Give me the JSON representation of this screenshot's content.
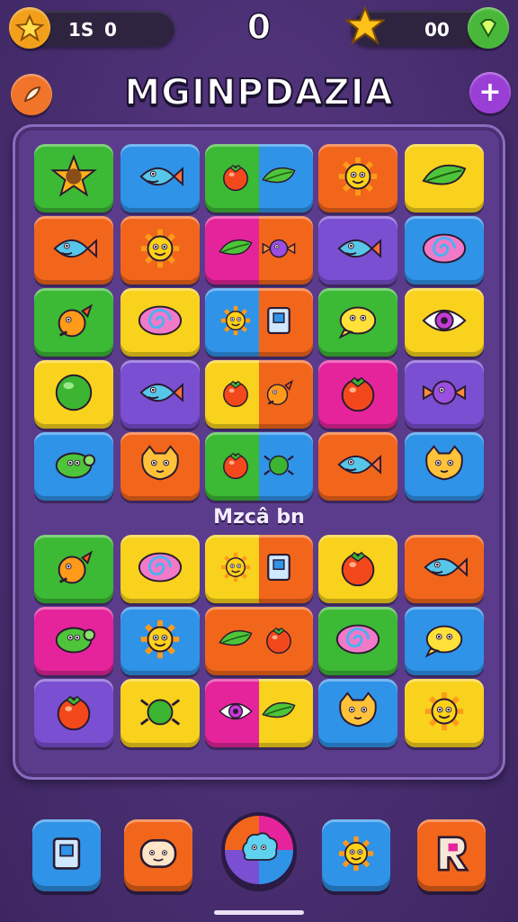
{
  "hud": {
    "left_counter_a": "1̸",
    "left_counter_text": "1S",
    "left_counter_value": "0",
    "score": "0",
    "right_counter_value": "00"
  },
  "title": "MGINPDAZIA",
  "section_label": "Mzcâ bn",
  "colors": {
    "green": "#3cb935",
    "blue": "#2f93e8",
    "orange": "#f2661b",
    "yellow": "#f8d21c",
    "pink": "#e5249c",
    "purple": "#7a4fd1",
    "board": "#5b3c8c"
  },
  "grid_top": [
    [
      {
        "c": "green",
        "icon": "star-creature-icon"
      },
      {
        "c": "blue",
        "icon": "fish-icon"
      },
      {
        "c": "green|blue",
        "icon": "pepper-feather-icon"
      },
      {
        "c": "orange",
        "icon": "sun-icon"
      },
      {
        "c": "yellow",
        "icon": "leaf-icon"
      }
    ],
    [
      {
        "c": "orange",
        "icon": "fish-icon"
      },
      {
        "c": "orange",
        "icon": "sun-icon"
      },
      {
        "c": "pink|orange",
        "icon": "leaf-candy-icon"
      },
      {
        "c": "purple",
        "icon": "fish-icon"
      },
      {
        "c": "blue",
        "icon": "swirl-eye-icon"
      }
    ],
    [
      {
        "c": "green",
        "icon": "bird-icon"
      },
      {
        "c": "yellow",
        "icon": "swirl-candy-icon"
      },
      {
        "c": "blue|orange",
        "icon": "sun-can-icon"
      },
      {
        "c": "green",
        "icon": "chick-icon"
      },
      {
        "c": "yellow",
        "icon": "eye-icon"
      }
    ],
    [
      {
        "c": "yellow",
        "icon": "ball-icon"
      },
      {
        "c": "purple",
        "icon": "fish-icon"
      },
      {
        "c": "yellow|orange",
        "icon": "berry-carrot-icon"
      },
      {
        "c": "pink",
        "icon": "tomato-icon"
      },
      {
        "c": "purple",
        "icon": "candy-icon"
      }
    ],
    [
      {
        "c": "blue",
        "icon": "turtle-icon"
      },
      {
        "c": "orange",
        "icon": "cat-icon"
      },
      {
        "c": "green|blue",
        "icon": "pepper-bug-icon"
      },
      {
        "c": "orange",
        "icon": "fish-icon"
      },
      {
        "c": "blue",
        "icon": "cat-icon"
      }
    ]
  ],
  "grid_bottom": [
    [
      {
        "c": "green",
        "icon": "bird-icon"
      },
      {
        "c": "yellow",
        "icon": "swirl-eye-icon"
      },
      {
        "c": "yellow|orange",
        "icon": "sun-can-icon"
      },
      {
        "c": "yellow",
        "icon": "tomato-icon"
      },
      {
        "c": "orange",
        "icon": "fish-icon"
      }
    ],
    [
      {
        "c": "pink",
        "icon": "turtle-icon"
      },
      {
        "c": "blue",
        "icon": "sun-icon"
      },
      {
        "c": "orange|orange",
        "icon": "torch-carrot-icon"
      },
      {
        "c": "green",
        "icon": "swirl-candy-icon"
      },
      {
        "c": "blue",
        "icon": "chick-icon"
      }
    ],
    [
      {
        "c": "purple",
        "icon": "tomato-icon"
      },
      {
        "c": "yellow",
        "icon": "bug-icon"
      },
      {
        "c": "pink|yellow",
        "icon": "eye-feather-icon"
      },
      {
        "c": "blue",
        "icon": "cat-icon"
      },
      {
        "c": "yellow",
        "icon": "sun-icon"
      }
    ]
  ],
  "bottom_bar": [
    {
      "name": "letter-block-button",
      "icon": "block-icon",
      "c": "blue"
    },
    {
      "name": "face-button",
      "icon": "face-icon",
      "c": "orange"
    },
    {
      "name": "center-play-button",
      "icon": "cloud-creature-icon",
      "c": "multi"
    },
    {
      "name": "sun-button",
      "icon": "sun-icon",
      "c": "blue"
    },
    {
      "name": "r-block-button",
      "icon": "r-block-icon",
      "c": "orange"
    }
  ]
}
